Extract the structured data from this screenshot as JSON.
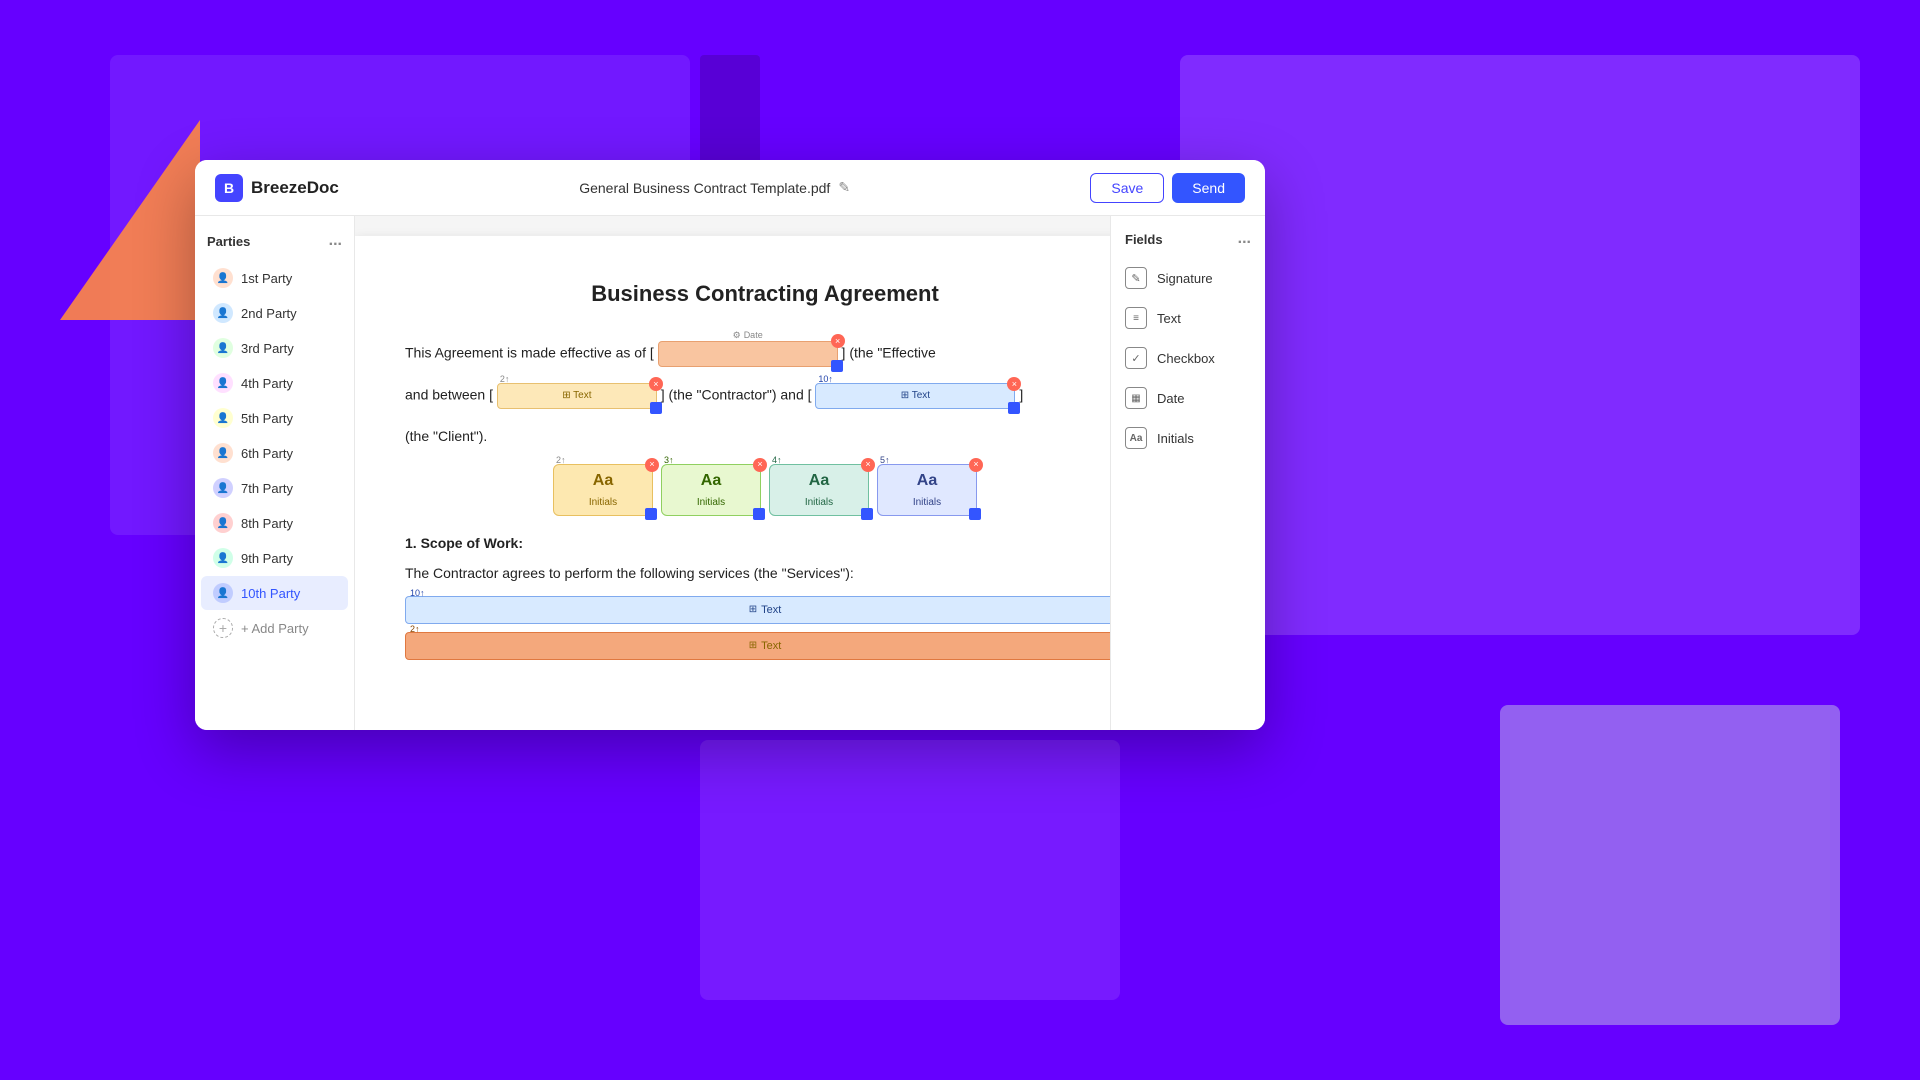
{
  "background": {
    "color": "#6600ff"
  },
  "app": {
    "logo": "B",
    "name": "BreezeDoc",
    "filename": "General Business Contract Template.pdf",
    "save_label": "Save",
    "send_label": "Send"
  },
  "sidebar": {
    "header": "Parties",
    "more_icon": "...",
    "parties": [
      {
        "id": 1,
        "label": "1st Party",
        "active": false
      },
      {
        "id": 2,
        "label": "2nd Party",
        "active": false
      },
      {
        "id": 3,
        "label": "3rd Party",
        "active": false
      },
      {
        "id": 4,
        "label": "4th Party",
        "active": false
      },
      {
        "id": 5,
        "label": "5th Party",
        "active": false
      },
      {
        "id": 6,
        "label": "6th Party",
        "active": false
      },
      {
        "id": 7,
        "label": "7th Party",
        "active": false
      },
      {
        "id": 8,
        "label": "8th Party",
        "active": false
      },
      {
        "id": 9,
        "label": "9th Party",
        "active": false
      },
      {
        "id": 10,
        "label": "10th Party",
        "active": true
      }
    ],
    "add_party_label": "+ Add Party"
  },
  "document": {
    "title": "Business Contracting Agreement",
    "para1_start": "This Agreement is made effective as of [",
    "para1_end": "] (the \"Effective",
    "para2_start": "and between [",
    "para2_mid": "] (the \"Contractor\") and [",
    "para2_end": "]",
    "para3": "(the \"Client\").",
    "scope_heading": "1. Scope of Work:",
    "scope_para": "The   Contractor   agrees   to   perform   the   following   services   (the   \"Services\"):"
  },
  "fields": {
    "panel_header": "Fields",
    "more_icon": "...",
    "items": [
      {
        "id": "signature",
        "label": "Signature",
        "icon": "✏"
      },
      {
        "id": "text",
        "label": "Text",
        "icon": "≡"
      },
      {
        "id": "checkbox",
        "label": "Checkbox",
        "icon": "✓"
      },
      {
        "id": "date",
        "label": "Date",
        "icon": "▦"
      },
      {
        "id": "initials",
        "label": "Initials",
        "icon": "Aa"
      }
    ]
  },
  "doc_fields": {
    "date_label": "Date",
    "text_label": "Text",
    "initials_label": "Initials",
    "party2_icon": "2↑",
    "party10_icon": "10↑"
  }
}
